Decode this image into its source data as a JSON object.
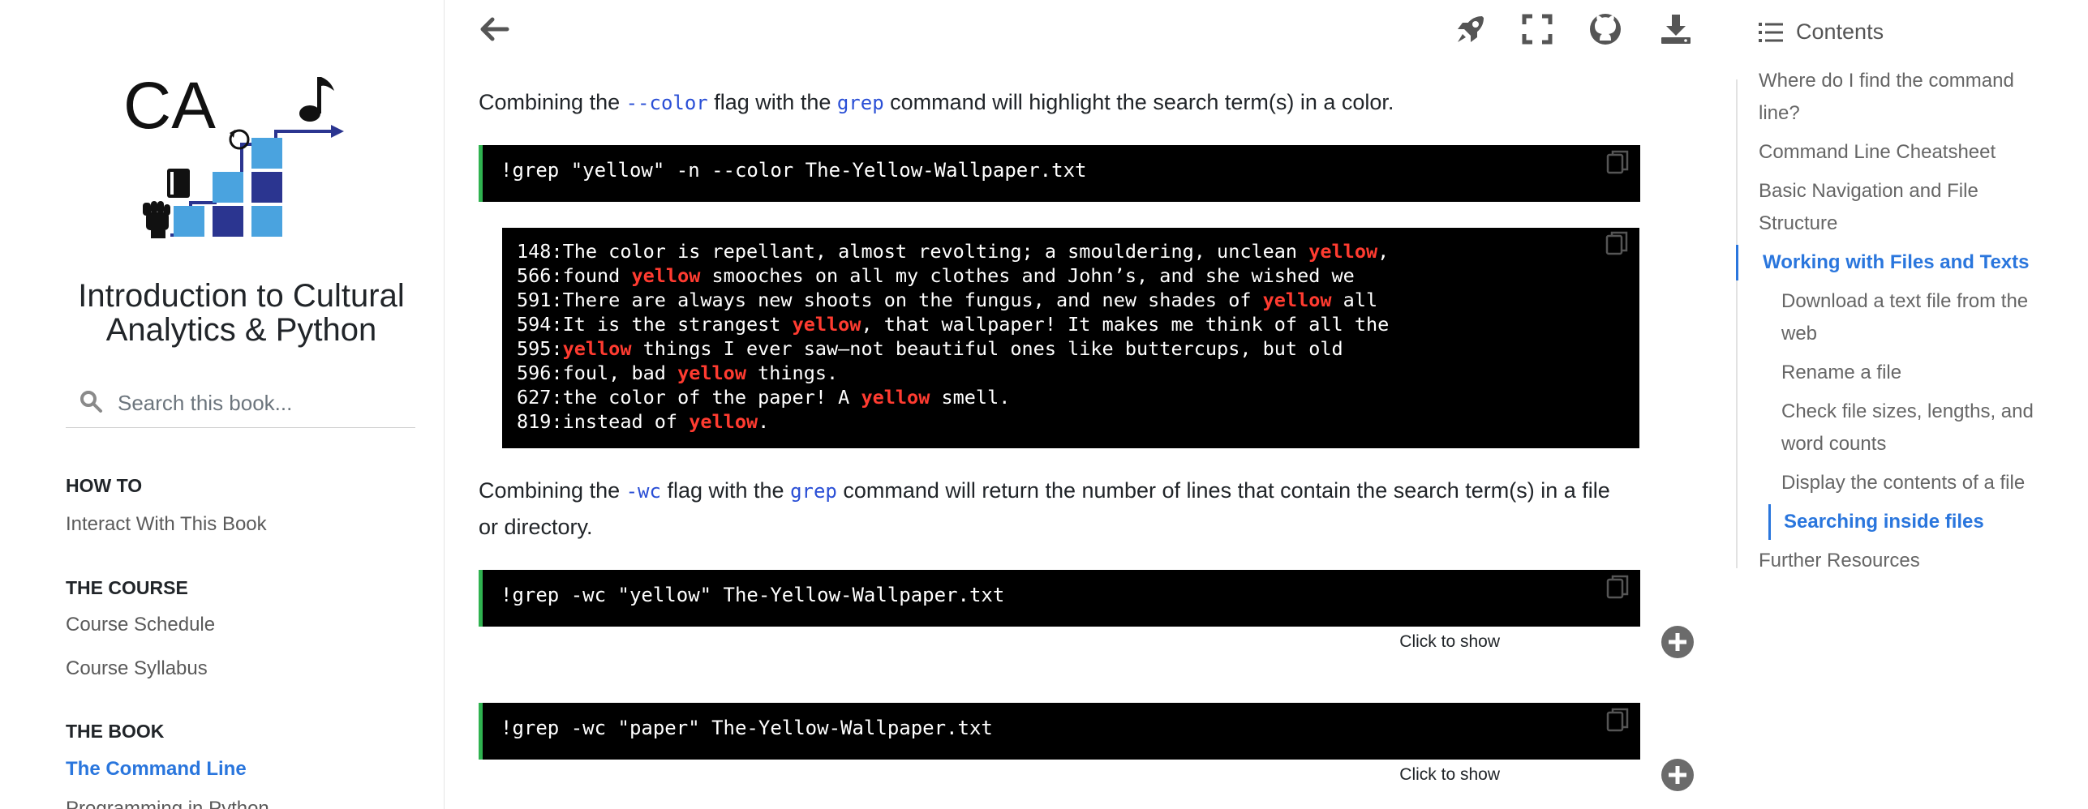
{
  "book": {
    "title_line1": "Introduction to Cultural",
    "title_line2": "Analytics & Python",
    "logo_text": "CA"
  },
  "search": {
    "placeholder": "Search this book..."
  },
  "nav": {
    "sections": [
      {
        "caption": "HOW TO",
        "items": [
          "Interact With This Book"
        ]
      },
      {
        "caption": "THE COURSE",
        "items": [
          "Course Schedule",
          "Course Syllabus"
        ]
      },
      {
        "caption": "THE BOOK",
        "items": [
          "The Command Line",
          "Programming in Python"
        ]
      }
    ],
    "active_item": "The Command Line"
  },
  "topbar": {
    "icons": [
      "back-arrow-icon",
      "rocket-icon",
      "fullscreen-icon",
      "github-icon",
      "download-icon"
    ]
  },
  "content": {
    "para1": {
      "before": "Combining the ",
      "code1": "--color",
      "middle": " flag with the ",
      "code2": "grep",
      "after": " command will highlight the search term(s) in a color."
    },
    "cell1_code": "!grep \"yellow\" -n --color The-Yellow-Wallpaper.txt",
    "output_lines": [
      {
        "pre": "148:The color is repellant, almost revolting; a smouldering, unclean ",
        "hl": "yellow",
        "post": ","
      },
      {
        "pre": "566:found ",
        "hl": "yellow",
        "post": " smooches on all my clothes and John’s, and she wished we"
      },
      {
        "pre": "591:There are always new shoots on the fungus, and new shades of ",
        "hl": "yellow",
        "post": " all"
      },
      {
        "pre": "594:It is the strangest ",
        "hl": "yellow",
        "post": ", that wallpaper! It makes me think of all the"
      },
      {
        "pre": "595:",
        "hl": "yellow",
        "post": " things I ever saw—not beautiful ones like buttercups, but old"
      },
      {
        "pre": "596:foul, bad ",
        "hl": "yellow",
        "post": " things."
      },
      {
        "pre": "627:the color of the paper! A ",
        "hl": "yellow",
        "post": " smell."
      },
      {
        "pre": "819:instead of ",
        "hl": "yellow",
        "post": "."
      }
    ],
    "para2": {
      "before": "Combining the ",
      "code1": "-wc",
      "middle": " flag with the ",
      "code2": "grep",
      "after": " command will return the number of lines that contain the search term(s) in a file or directory."
    },
    "cell2_code": "!grep -wc \"yellow\" The-Yellow-Wallpaper.txt",
    "cell3_code": "!grep -wc \"paper\" The-Yellow-Wallpaper.txt",
    "toggle_label": "Click to show"
  },
  "toc": {
    "title": "Contents",
    "items": [
      {
        "label_lines": [
          "Where do I find the command",
          "line?"
        ],
        "level": 1,
        "active": false
      },
      {
        "label_lines": [
          "Command Line Cheatsheet"
        ],
        "level": 1,
        "active": false
      },
      {
        "label_lines": [
          "Basic Navigation and File",
          "Structure"
        ],
        "level": 1,
        "active": false
      },
      {
        "label_lines": [
          "Working with Files and Texts"
        ],
        "level": 1,
        "active": true
      },
      {
        "label_lines": [
          "Download a text file from the",
          "web"
        ],
        "level": 2,
        "active": false
      },
      {
        "label_lines": [
          "Rename a file"
        ],
        "level": 2,
        "active": false
      },
      {
        "label_lines": [
          "Check file sizes, lengths, and",
          "word counts"
        ],
        "level": 2,
        "active": false
      },
      {
        "label_lines": [
          "Display the contents of a file"
        ],
        "level": 2,
        "active": false
      },
      {
        "label_lines": [
          "Searching inside files"
        ],
        "level": 2,
        "active": true
      },
      {
        "label_lines": [
          "Further Resources"
        ],
        "level": 1,
        "active": false
      }
    ]
  },
  "colors": {
    "accent_blue": "#2a76dd",
    "inline_code": "#2a4fd6",
    "highlight_red": "#ff3b30",
    "cell_border_green": "#2fb250"
  }
}
